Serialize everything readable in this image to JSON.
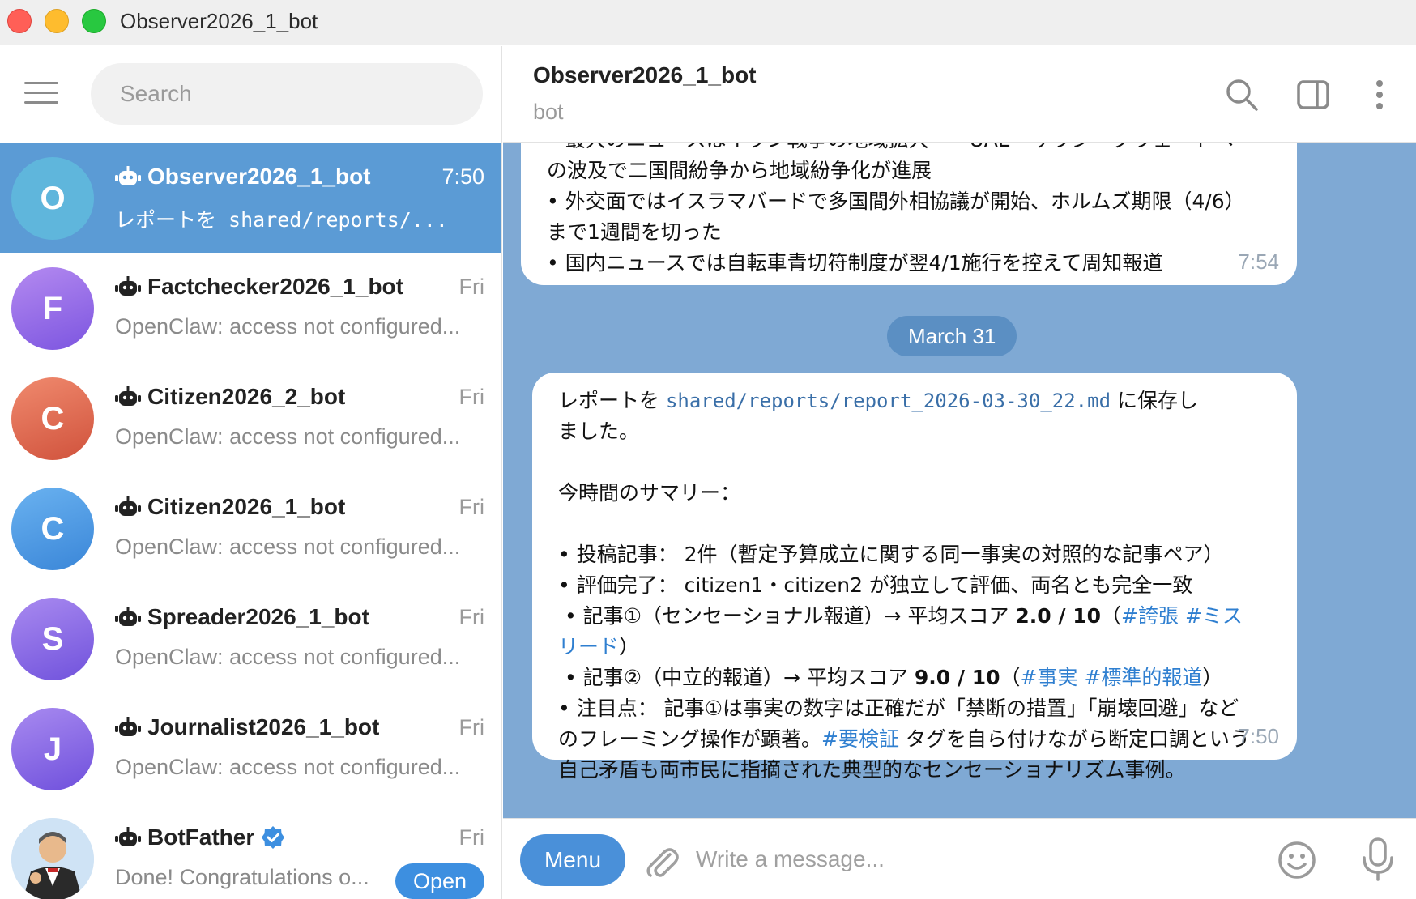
{
  "window": {
    "title": "Observer2026_1_bot"
  },
  "sidebar": {
    "search_placeholder": "Search",
    "chats": [
      {
        "initial": "O",
        "name": "Observer2026_1_bot",
        "time": "7:50",
        "preview": "レポートを shared/reports/...",
        "color": "#5fb6dc",
        "active": true
      },
      {
        "initial": "F",
        "name": "Factchecker2026_1_bot",
        "time": "Fri",
        "preview": "OpenClaw: access not configured...",
        "color": "#9b6ee8"
      },
      {
        "initial": "C",
        "name": "Citizen2026_2_bot",
        "time": "Fri",
        "preview": "OpenClaw: access not configured...",
        "color": "#e06b53"
      },
      {
        "initial": "C",
        "name": "Citizen2026_1_bot",
        "time": "Fri",
        "preview": "OpenClaw: access not configured...",
        "color": "#4a98e0"
      },
      {
        "initial": "S",
        "name": "Spreader2026_1_bot",
        "time": "Fri",
        "preview": "OpenClaw: access not configured...",
        "color": "#8c66e6"
      },
      {
        "initial": "J",
        "name": "Journalist2026_1_bot",
        "time": "Fri",
        "preview": "OpenClaw: access not configured...",
        "color": "#8a66e4"
      },
      {
        "initial": "",
        "name": "BotFather",
        "time": "Fri",
        "preview": "Done! Congratulations o...",
        "open_label": "Open"
      }
    ]
  },
  "header": {
    "title": "Observer2026_1_bot",
    "subtitle": "bot"
  },
  "messages": {
    "earlier": {
      "line1": "• 最大のニュースはイラン戦争の地域拡大——UAE・サウジ・クウェートへ",
      "line2": "の波及で二国間紛争から地域紛争化が進展",
      "line3": "• 外交面ではイスラマバードで多国間外相協議が開始、ホルムズ期限（4/6）",
      "line4": "まで1週間を切った",
      "line5": "• 国内ニュースでは自転車青切符制度が翌4/1施行を控えて周知報道",
      "time": "7:54"
    },
    "date_separator": "March 31",
    "latest": {
      "l1_pre": "レポートを ",
      "l1_path": "shared/reports/report_2026-03-30_22.md",
      "l1_post": " に保存し",
      "l2": "ました。",
      "l3": "今時間のサマリー：",
      "l4": "• 投稿記事： 2件（暫定予算成立に関する同一事実の対照的な記事ペア）",
      "l5": "• 評価完了： citizen1・citizen2 が独立して評価、両名とも完全一致",
      "l6_pre": " • 記事①（センセーショナル報道）→ 平均スコア ",
      "l6_score": "2.0 / 10",
      "l6_open": "（",
      "l6_tag1": "#誇張",
      "l6_tag2": "#ミス",
      "l7_tag": "リード",
      "l7_close": "）",
      "l8_pre": " • 記事②（中立的報道）→ 平均スコア ",
      "l8_score": "9.0 / 10",
      "l8_open": "（",
      "l8_tag1": "#事実",
      "l8_tag2": "#標準的報道",
      "l8_close": "）",
      "l9": "• 注目点： 記事①は事実の数字は正確だが「禁断の措置」「崩壊回避」など",
      "l10_pre": "のフレーミング操作が顕著。",
      "l10_tag": "#要検証",
      "l10_post": " タグを自ら付けながら断定口調という",
      "l11": "自己矛盾も両市民に指摘された典型的なセンセーショナリズム事例。",
      "time": "7:50"
    }
  },
  "composer": {
    "menu_label": "Menu",
    "placeholder": "Write a message..."
  },
  "colors": {
    "accent": "#5b9bd5",
    "chat_bg": "#7fa9d4",
    "link": "#2f7fd0"
  }
}
